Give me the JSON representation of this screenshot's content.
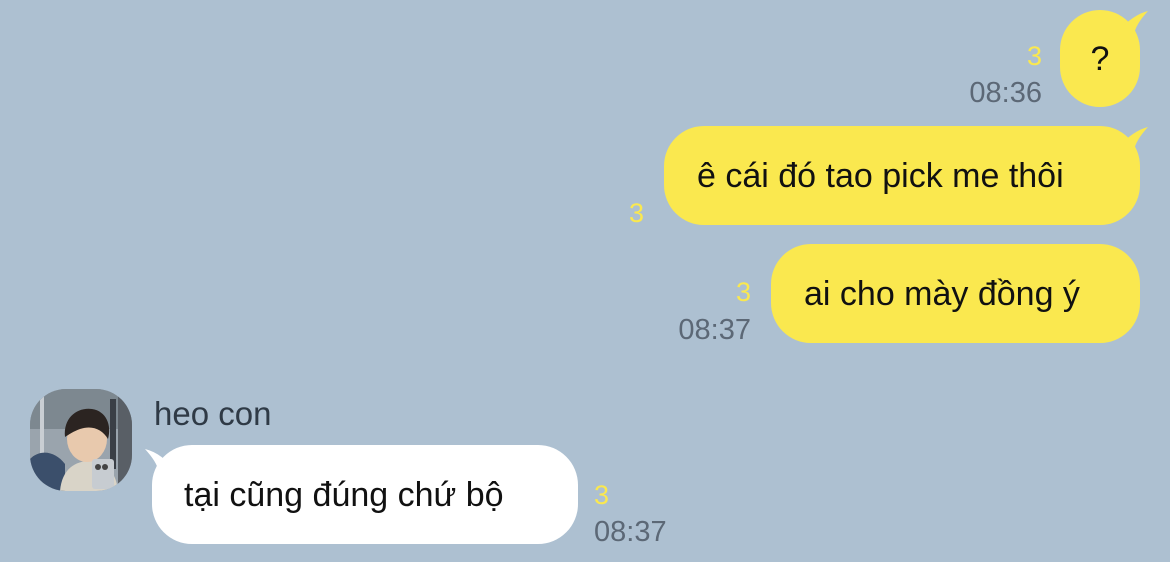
{
  "messages": [
    {
      "id": "m1",
      "sender": "me",
      "text": "?",
      "read_count": "3",
      "time": "08:36"
    },
    {
      "id": "m2",
      "sender": "me",
      "text": "ê cái đó tao pick me thôi",
      "read_count": "3",
      "time": ""
    },
    {
      "id": "m3",
      "sender": "me",
      "text": "ai cho mày đồng ý",
      "read_count": "3",
      "time": "08:37"
    },
    {
      "id": "m4",
      "sender": "other",
      "sender_name": "heo con",
      "text": "tại cũng đúng chứ bộ",
      "read_count": "3",
      "time": "08:37"
    }
  ],
  "colors": {
    "background": "#adc0d1",
    "my_bubble": "#fae84f",
    "their_bubble": "#ffffff",
    "read_indicator": "#fae84f",
    "timestamp": "#5c6876"
  }
}
